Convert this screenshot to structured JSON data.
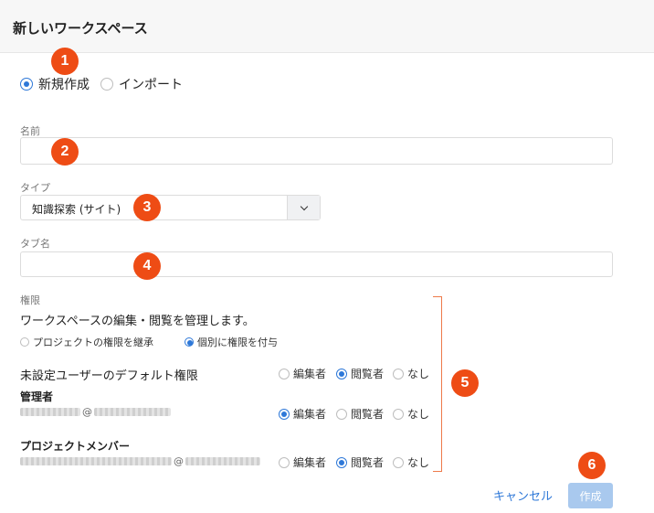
{
  "dialog": {
    "title": "新しいワークスペース"
  },
  "mode": {
    "new_label": "新規作成",
    "import_label": "インポート",
    "selected": "new"
  },
  "name_field": {
    "label": "名前",
    "value": ""
  },
  "type_field": {
    "label": "タイプ",
    "value": "知識探索 (サイト)"
  },
  "tab_name_field": {
    "label": "タブ名",
    "value": ""
  },
  "permissions": {
    "label": "権限",
    "description": "ワークスペースの編集・閲覧を管理します。",
    "inherit_label": "プロジェクトの権限を継承",
    "individual_label": "個別に権限を付与",
    "default_label": "未設定ユーザーのデフォルト権限",
    "admins_label": "管理者",
    "members_label": "プロジェクトメンバー",
    "at": "@",
    "options": {
      "editor": "編集者",
      "viewer": "閲覧者",
      "none": "なし"
    }
  },
  "buttons": {
    "cancel": "キャンセル",
    "create": "作成"
  },
  "badges": [
    "1",
    "2",
    "3",
    "4",
    "5",
    "6"
  ],
  "colors": {
    "accent": "#2e78d8",
    "badge": "#ee4c15",
    "create_disabled": "#a9c9ee"
  }
}
